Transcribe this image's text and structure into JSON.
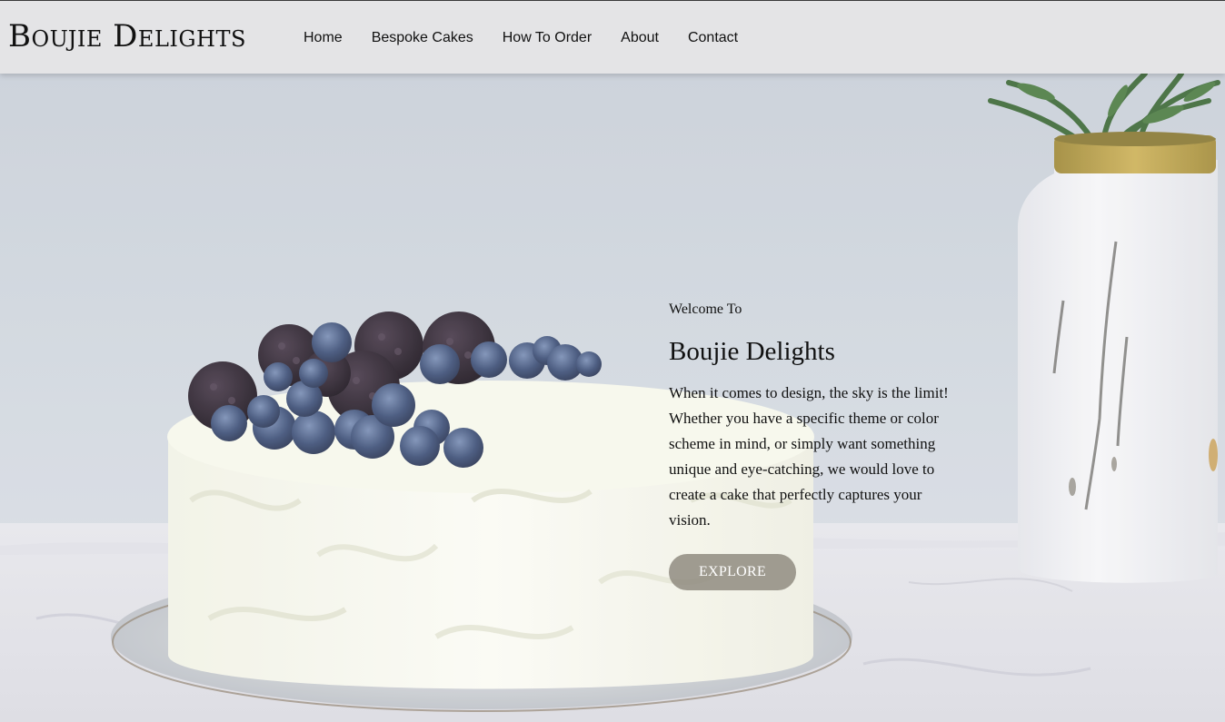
{
  "header": {
    "brand": "Boujie Delights",
    "nav": [
      {
        "label": "Home"
      },
      {
        "label": "Bespoke Cakes"
      },
      {
        "label": "How To Order"
      },
      {
        "label": "About"
      },
      {
        "label": "Contact"
      }
    ]
  },
  "hero": {
    "image": "cake-with-berries-image",
    "kicker": "Welcome To",
    "title": "Boujie Delights",
    "description": "When it comes to design, the sky is the limit! Whether you have a specific theme or color scheme in mind, or simply want something unique and eye-catching, we would love to create a cake that perfectly captures your vision.",
    "cta_label": "EXPLORE"
  },
  "colors": {
    "header_bg": "#e4e4e6",
    "button_bg": "#8c877d",
    "text": "#111111"
  }
}
